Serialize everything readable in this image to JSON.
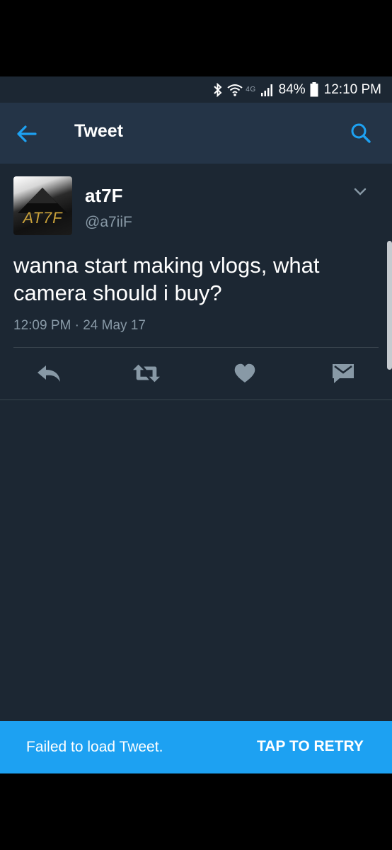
{
  "status_bar": {
    "network": "4G",
    "battery": "84%",
    "time": "12:10 PM"
  },
  "app_bar": {
    "title": "Tweet",
    "back_icon": "arrow-left-icon",
    "search_icon": "search-icon"
  },
  "tweet": {
    "avatar_text": "AT7F",
    "display_name": "at7F",
    "handle": "@a7iiF",
    "text": "wanna start making vlogs, what camera should i buy?",
    "timestamp": "12:09 PM · 24 May 17",
    "actions": [
      "reply-icon",
      "retweet-icon",
      "like-icon",
      "direct-message-icon"
    ]
  },
  "snackbar": {
    "message": "Failed to load Tweet.",
    "action": "TAP TO RETRY"
  },
  "colors": {
    "background": "#1c2733",
    "app_bar": "#243447",
    "accent": "#1da1f2",
    "secondary_text": "#8899a6",
    "icon": "#8899a6"
  }
}
